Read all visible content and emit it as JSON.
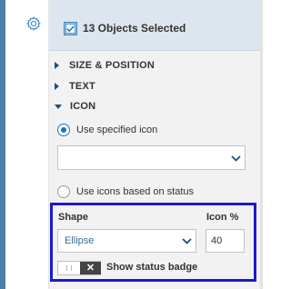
{
  "header": {
    "title": "13 Objects Selected"
  },
  "sections": [
    {
      "label": "SIZE & POSITION",
      "expanded": false
    },
    {
      "label": "TEXT",
      "expanded": false
    },
    {
      "label": "ICON",
      "expanded": true
    }
  ],
  "icon": {
    "options": [
      {
        "label": "Use specified icon",
        "selected": true
      },
      {
        "label": "Use icons based on status",
        "selected": false
      }
    ],
    "icon_select_value": ""
  },
  "shape": {
    "label": "Shape",
    "value": "Ellipse",
    "icon_pct_label": "Icon %",
    "icon_pct_value": "40"
  },
  "status_badge": {
    "label": "Show status badge",
    "enabled": false
  },
  "colors": {
    "accent": "#1e74b4",
    "highlight_border": "#1a1acf",
    "header_bg": "#dde6ee"
  },
  "icons": [
    "gear-icon",
    "checkbox-icon",
    "chevron-down-icon",
    "toggle-x-icon"
  ]
}
